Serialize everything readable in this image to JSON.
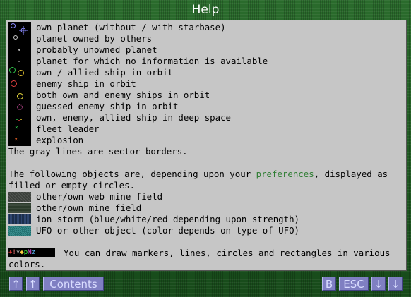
{
  "window": {
    "title": "Help"
  },
  "legend": {
    "lines": [
      "own planet (without / with starbase)",
      "planet owned by others",
      "probably unowned planet",
      "planet for which no information is available",
      "own / allied ship in orbit",
      "enemy ship in orbit",
      "both own and enemy ships in orbit",
      "guessed enemy ship in orbit",
      "own, enemy, allied ship in deep space",
      "fleet leader",
      "explosion"
    ],
    "note": "The gray lines are sector borders."
  },
  "fill": {
    "intro_before": "The following objects are, depending upon your ",
    "link": "preferences",
    "intro_after": ", displayed as",
    "intro_line2": "filled or empty circles.",
    "items": [
      {
        "label": "other/own web mine field",
        "color": "#3b403b"
      },
      {
        "label": "other/own mine field",
        "color": "#2b3b2b"
      },
      {
        "label": "ion storm (blue/white/red depending upon strength)",
        "color": "#1b2f4b"
      },
      {
        "label": "UFO or other object (color depends on type of UFO)",
        "color": "#1e6b6b"
      }
    ]
  },
  "markers": {
    "glyphs": "+!×◆pMz",
    "line1": "You can draw markers, lines, circles and rectangles in various",
    "line2": "colors."
  },
  "buttons": {
    "up1": "↑",
    "up2": "↑",
    "contents": "Contents",
    "b": "B",
    "esc": "ESC",
    "down1": "↓",
    "down2": "↓"
  },
  "colors": {
    "button_face": "#7f7fc2",
    "button_text": "#d9dcff",
    "panel": "#c6c6c6",
    "link": "#2e7d32"
  }
}
